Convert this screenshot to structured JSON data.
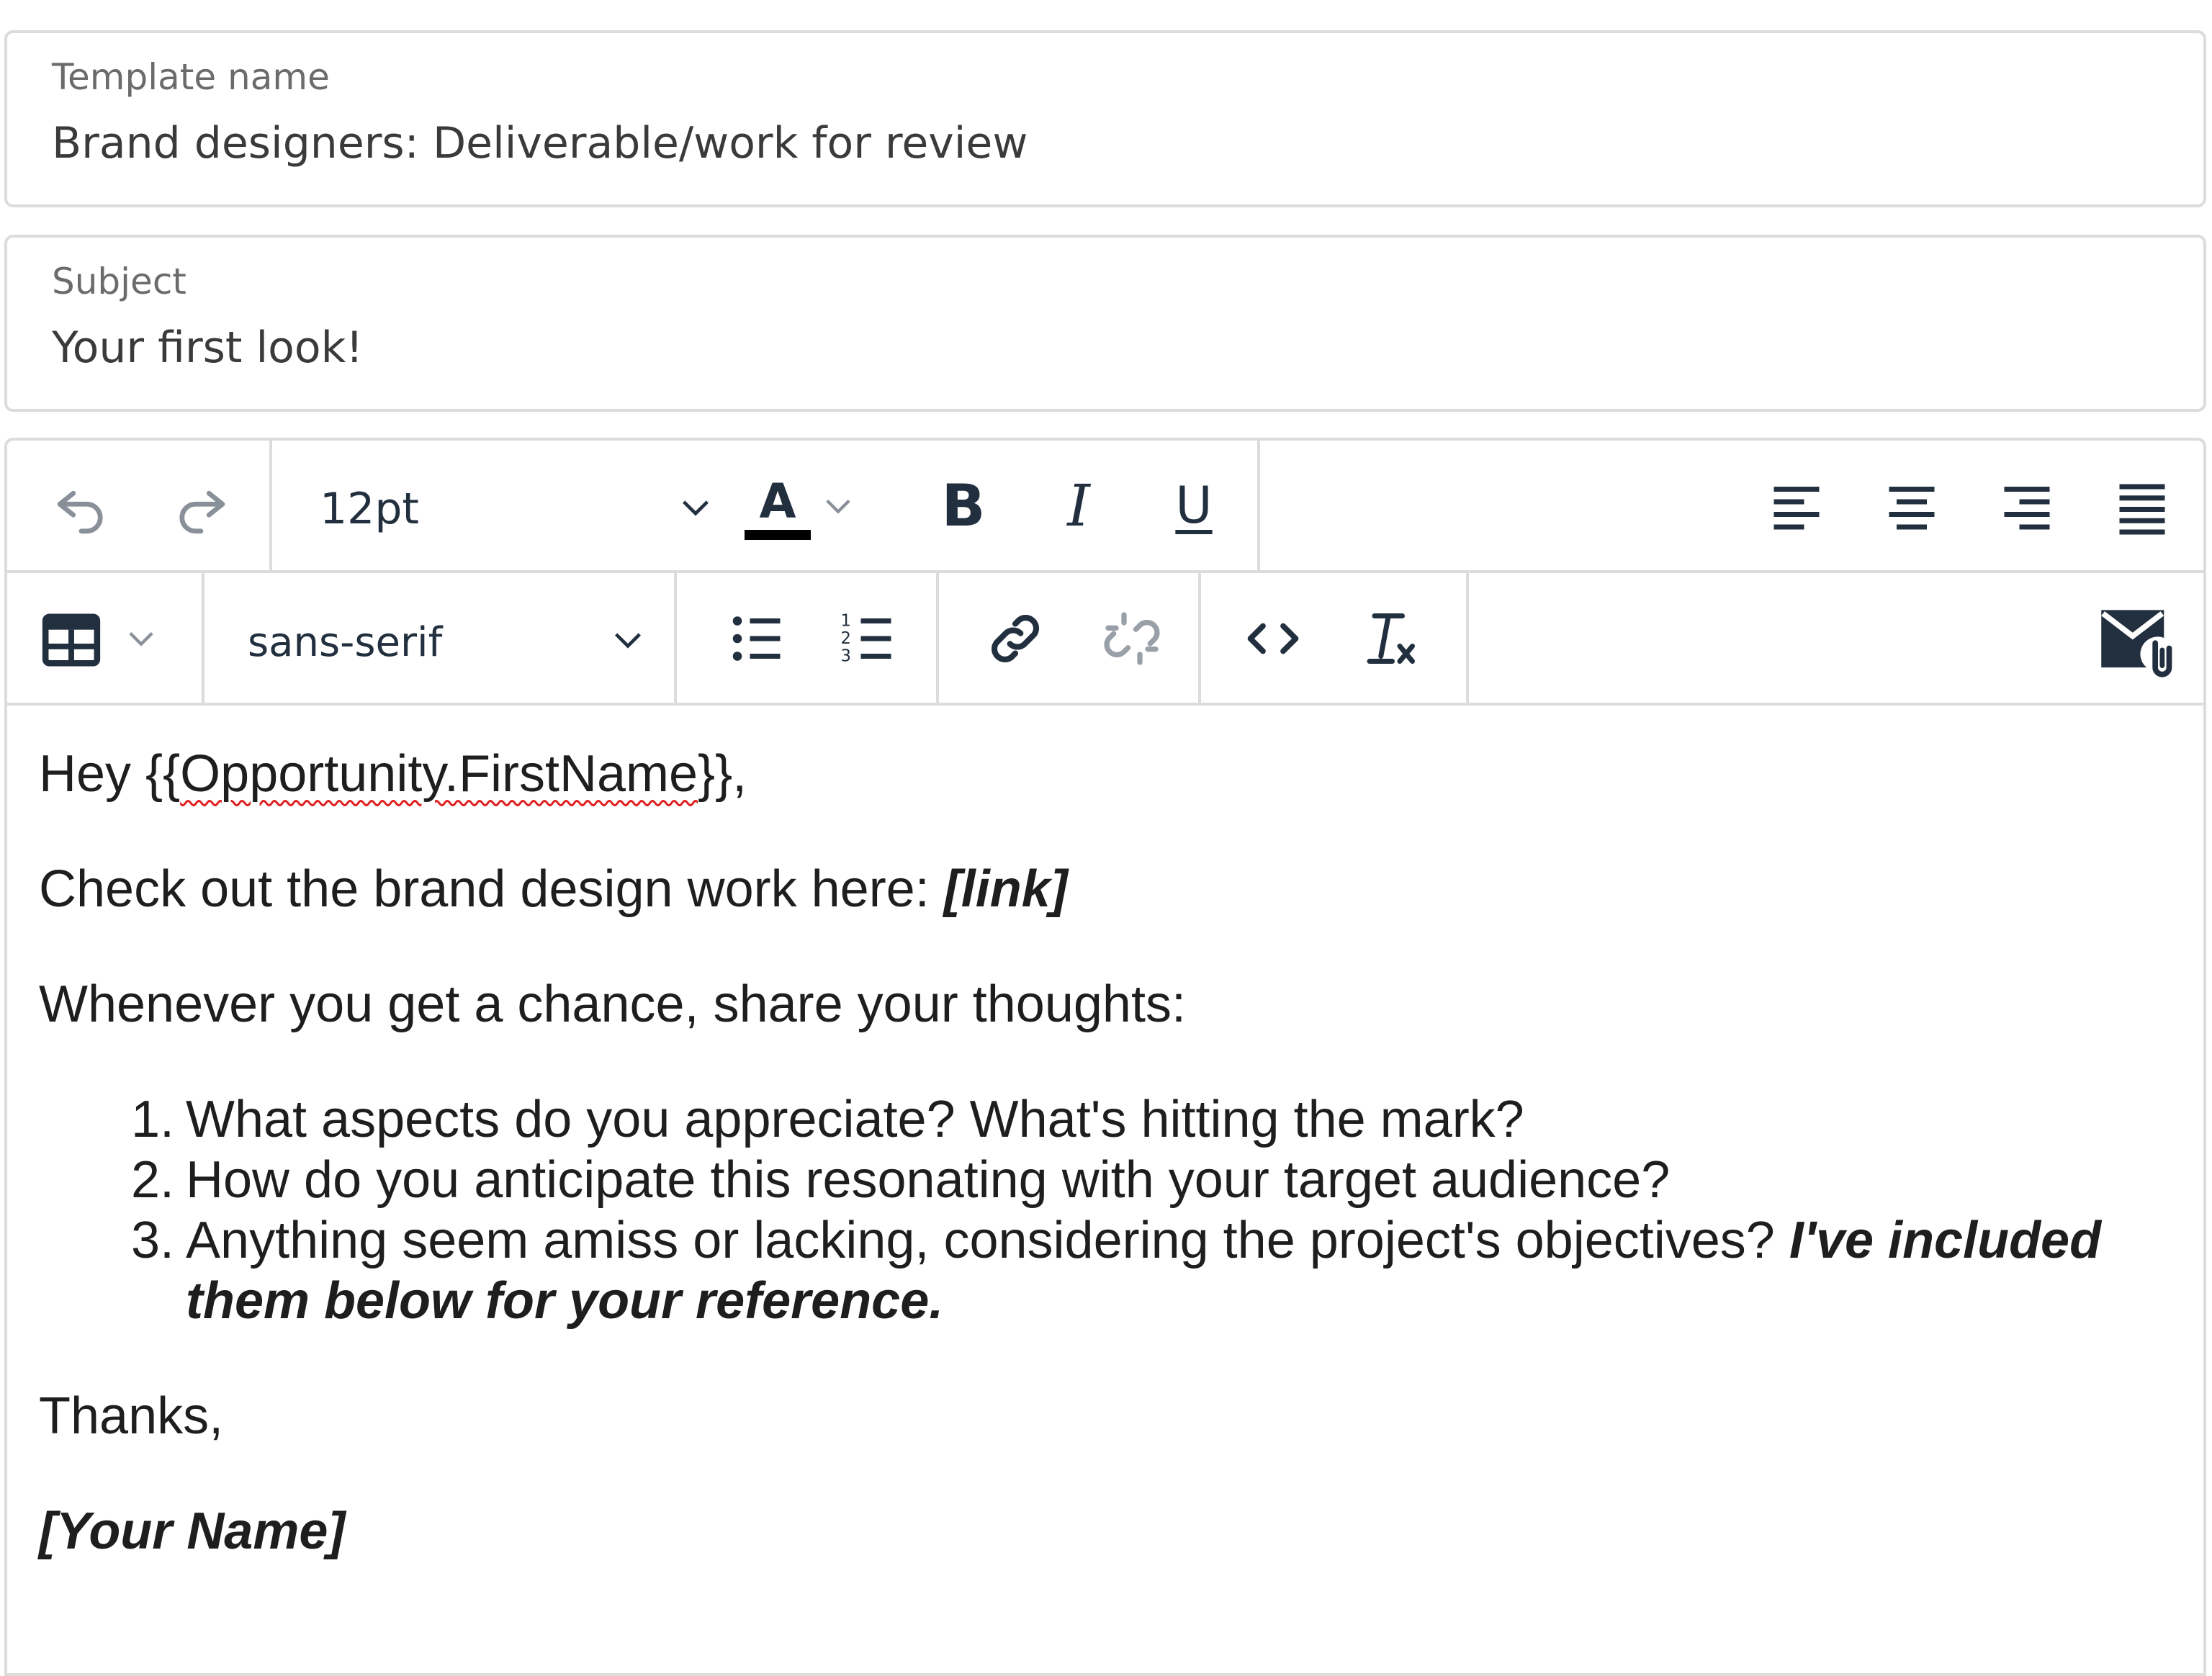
{
  "template_name": {
    "label": "Template name",
    "value": "Brand designers: Deliverable/work for review"
  },
  "subject": {
    "label": "Subject",
    "value": "Your first look!"
  },
  "toolbar": {
    "font_size": "12pt",
    "font_family": "sans-serif",
    "text_color_letter": "A",
    "bold_letter": "B",
    "italic_letter": "I",
    "underline_letter": "U",
    "accent_color": "#222f3e",
    "text_color_bar": "#000000"
  },
  "body": {
    "greeting_prefix": "Hey {{",
    "greeting_token": "Opportunity.FirstName",
    "greeting_suffix": "}},",
    "check_out_text": "Check out the brand design work here: ",
    "link_placeholder": "[link]",
    "intro": "Whenever you get a chance, share your thoughts:",
    "list_items": [
      {
        "num": "1.",
        "text": "What aspects do you appreciate? What's hitting the mark?"
      },
      {
        "num": "2.",
        "text": "How do you anticipate this resonating with your target audience?"
      },
      {
        "num": "3.",
        "text": "Anything seem amiss or lacking, considering the project's objectives? ",
        "emphasis_line1": "I've included",
        "emphasis_line2": "them below for your reference."
      }
    ],
    "thanks": "Thanks,",
    "signature": "[Your Name]"
  }
}
